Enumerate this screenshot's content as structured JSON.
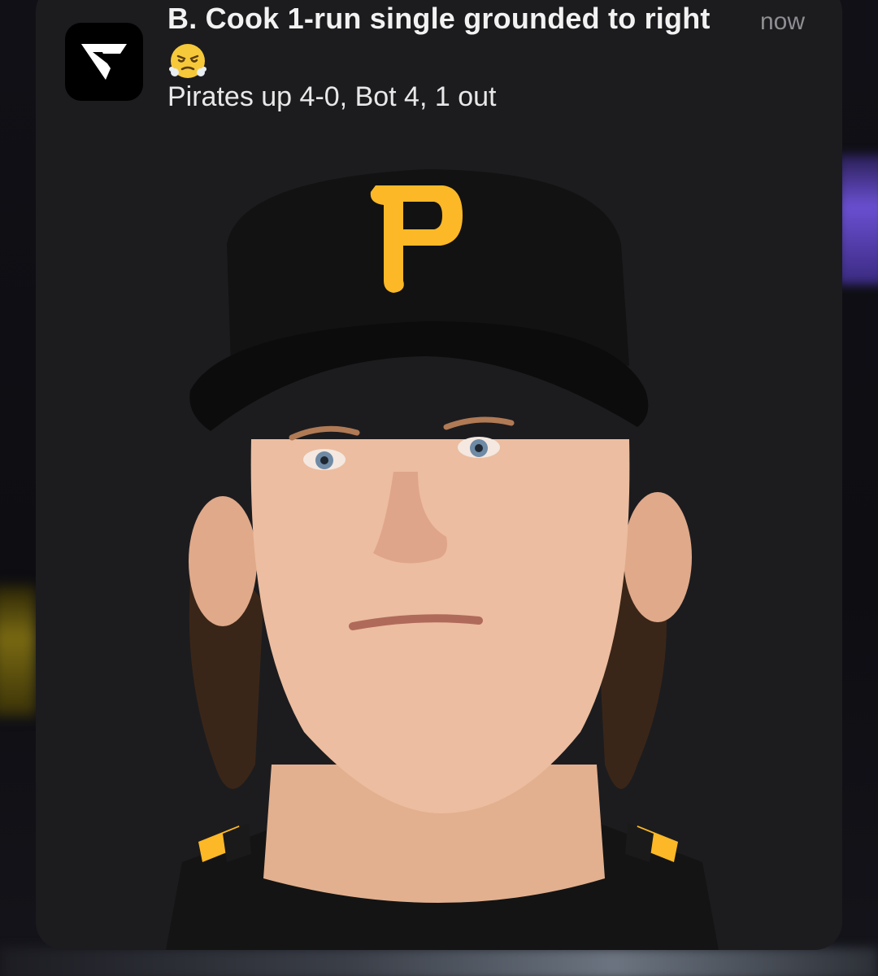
{
  "notification": {
    "app_icon": "v-logo-icon",
    "title": "B. Cook 1-run single grounded to right",
    "timestamp": "now",
    "emoji": "😤",
    "body": "Pirates up 4-0, Bot 4, 1 out",
    "image": "player headshot in black Pirates cap with yellow P logo"
  },
  "colors": {
    "card_background": "#1c1c1f",
    "title_text": "#f2f2f2",
    "timestamp_text": "#8e8e93",
    "pirates_gold": "#fdb827",
    "cap_black": "#111111"
  }
}
